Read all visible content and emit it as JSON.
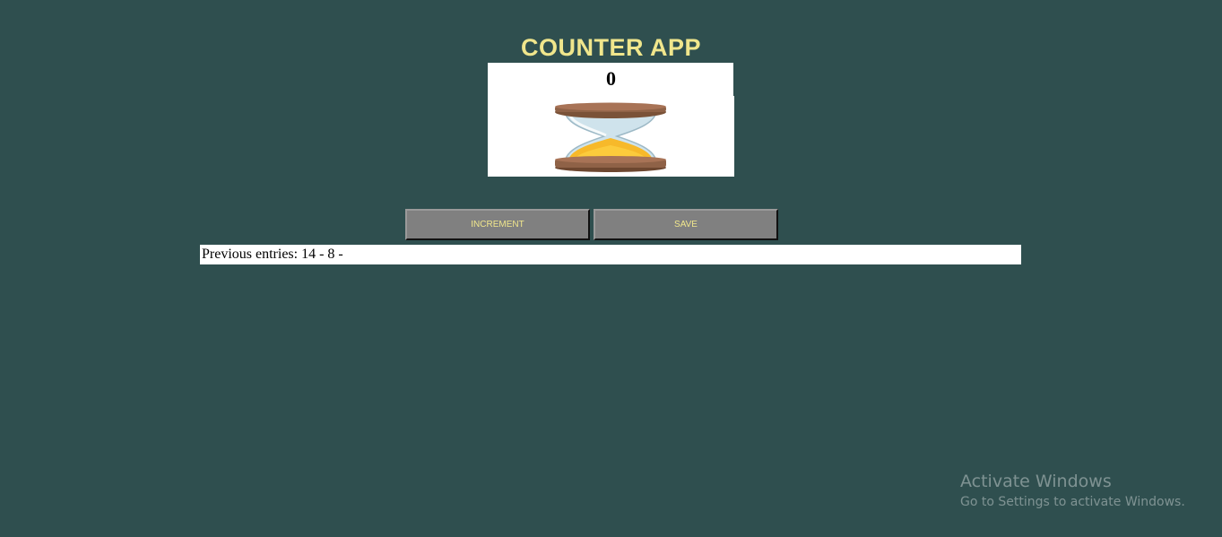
{
  "app": {
    "title": "COUNTER APP",
    "count": "0",
    "hourglass_icon": "hourglass-icon"
  },
  "buttons": {
    "increment_label": "INCREMENT",
    "save_label": "SAVE"
  },
  "entries": {
    "text": "Previous entries: 14 - 8 -"
  },
  "watermark": {
    "title": "Activate Windows",
    "subtitle": "Go to Settings to activate Windows."
  },
  "colors": {
    "background": "#2f4f4f",
    "title": "#f0e68c",
    "button_bg": "#808080",
    "button_text": "#f0e68c"
  }
}
